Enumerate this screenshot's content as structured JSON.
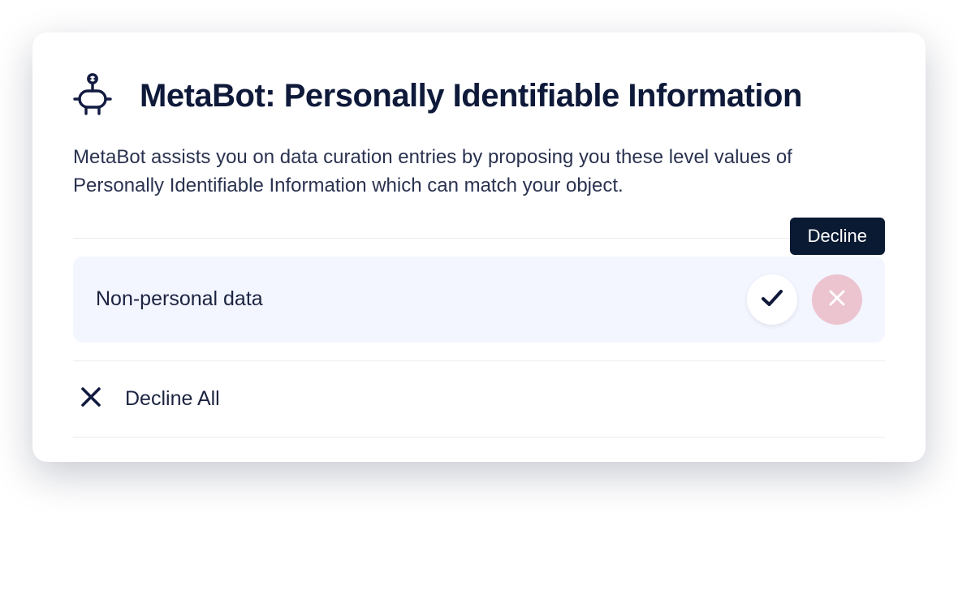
{
  "header": {
    "title": "MetaBot: Personally Identifiable Information"
  },
  "description": "MetaBot assists you on data curation entries by proposing you these level values of Personally Identifiable Information which can match your object.",
  "tooltip": "Decline",
  "suggestion": {
    "label": "Non-personal data"
  },
  "footer": {
    "decline_all": "Decline All"
  }
}
